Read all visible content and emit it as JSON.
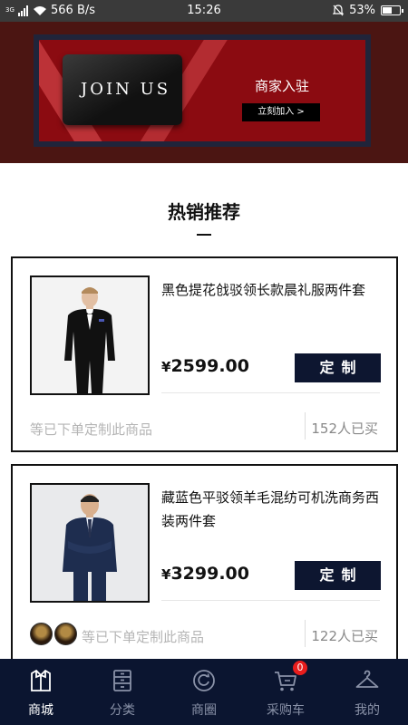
{
  "status_bar": {
    "network_label": "3G",
    "speed": "566 B/s",
    "time": "15:26",
    "battery": "53%",
    "battery_level": 0.53
  },
  "banner": {
    "card_text": "JOIN US",
    "title": "商家入驻",
    "button_label": "立刻加入 >"
  },
  "section": {
    "title": "热销推荐"
  },
  "products": [
    {
      "name": "黑色提花戗驳领长款晨礼服两件套",
      "currency": "¥",
      "price": "2599.00",
      "action_label": "定制",
      "footer_text": "等已下单定制此商品",
      "bought_text": "152人已买"
    },
    {
      "name": "藏蓝色平驳领羊毛混纺可机洗商务西装两件套",
      "currency": "¥",
      "price": "3299.00",
      "action_label": "定制",
      "footer_text": "等已下单定制此商品",
      "bought_text": "122人已买"
    }
  ],
  "bottom_nav": {
    "items": [
      {
        "label": "商城",
        "icon": "shirt-icon",
        "active": true
      },
      {
        "label": "分类",
        "icon": "cabinet-icon",
        "active": false
      },
      {
        "label": "商圈",
        "icon": "circle-refresh-icon",
        "active": false
      },
      {
        "label": "采购车",
        "icon": "cart-icon",
        "active": false,
        "badge": "0"
      },
      {
        "label": "我的",
        "icon": "hanger-icon",
        "active": false
      }
    ]
  },
  "colors": {
    "nav_bg": "#0b1530",
    "button_bg": "#0d1630",
    "banner_red": "#8b0b11",
    "badge_red": "#e81d1d"
  }
}
